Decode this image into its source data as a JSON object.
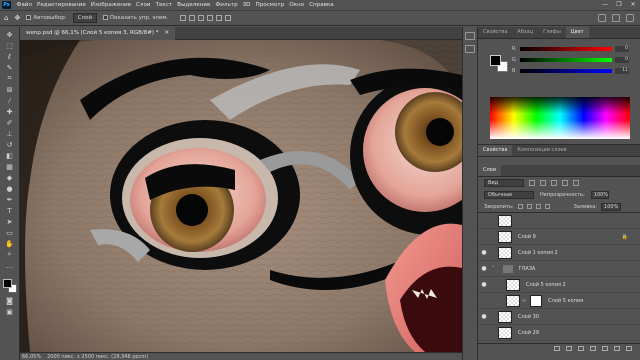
{
  "app": {
    "logo": "Ps"
  },
  "menu": [
    "Файл",
    "Редактирование",
    "Изображение",
    "Слои",
    "Текст",
    "Выделение",
    "Фильтр",
    "3D",
    "Просмотр",
    "Окно",
    "Справка"
  ],
  "window_controls": [
    "—",
    "❐",
    "✕"
  ],
  "options": {
    "autoselect_label": "Автовыбор:",
    "autoselect_value": "Слой",
    "show_controls_label": "Показать упр. элем."
  },
  "document": {
    "tab_title": "wenp.psd @ 66,1% (Слой 5 копия 3, RGB/8#) *",
    "close_glyph": "✕"
  },
  "status": {
    "zoom": "66,05%",
    "info": "2000 пикс. x 2500 пикс. (28,346 ppcm)"
  },
  "color_panel": {
    "tabs": [
      "Свойства",
      "Абзац",
      "Глифы",
      "Цвет"
    ],
    "active_tab": 3,
    "sliders": [
      {
        "label": "R",
        "value": "0"
      },
      {
        "label": "G",
        "value": "0"
      },
      {
        "label": "B",
        "value": "11"
      }
    ]
  },
  "properties_panel": {
    "tabs": [
      "Свойства",
      "Композиции слоев"
    ]
  },
  "layers_panel": {
    "tabs": [
      "Слои"
    ],
    "kind_label": "Вид",
    "blend_mode": "Обычные",
    "opacity_label": "Непрозрачность:",
    "opacity_value": "100%",
    "lock_label": "Закрепить:",
    "fill_label": "Заливка:",
    "fill_value": "100%",
    "items": [
      {
        "name": "",
        "visible": false,
        "type": "layer"
      },
      {
        "name": "Слой 9",
        "visible": false,
        "type": "layer",
        "locked": true
      },
      {
        "name": "Слой 1 копия 2",
        "visible": true,
        "type": "layer"
      },
      {
        "name": "ГЛАЗА",
        "visible": true,
        "type": "group"
      },
      {
        "name": "Слой 5 копия 2",
        "visible": true,
        "type": "layer",
        "indent": true
      },
      {
        "name": "Слой 5 копия",
        "visible": false,
        "type": "layer",
        "indent": true,
        "mask": true
      },
      {
        "name": "Слой 30",
        "visible": true,
        "type": "layer"
      },
      {
        "name": "Слой 29",
        "visible": false,
        "type": "layer"
      }
    ]
  },
  "colors": {
    "ui_bg": "#535353",
    "ui_dark": "#424242",
    "skin": "#8c7a6a",
    "eye_white": "#e8b4a8",
    "iris": "#9a6a2c",
    "lip": "#e87a78"
  }
}
